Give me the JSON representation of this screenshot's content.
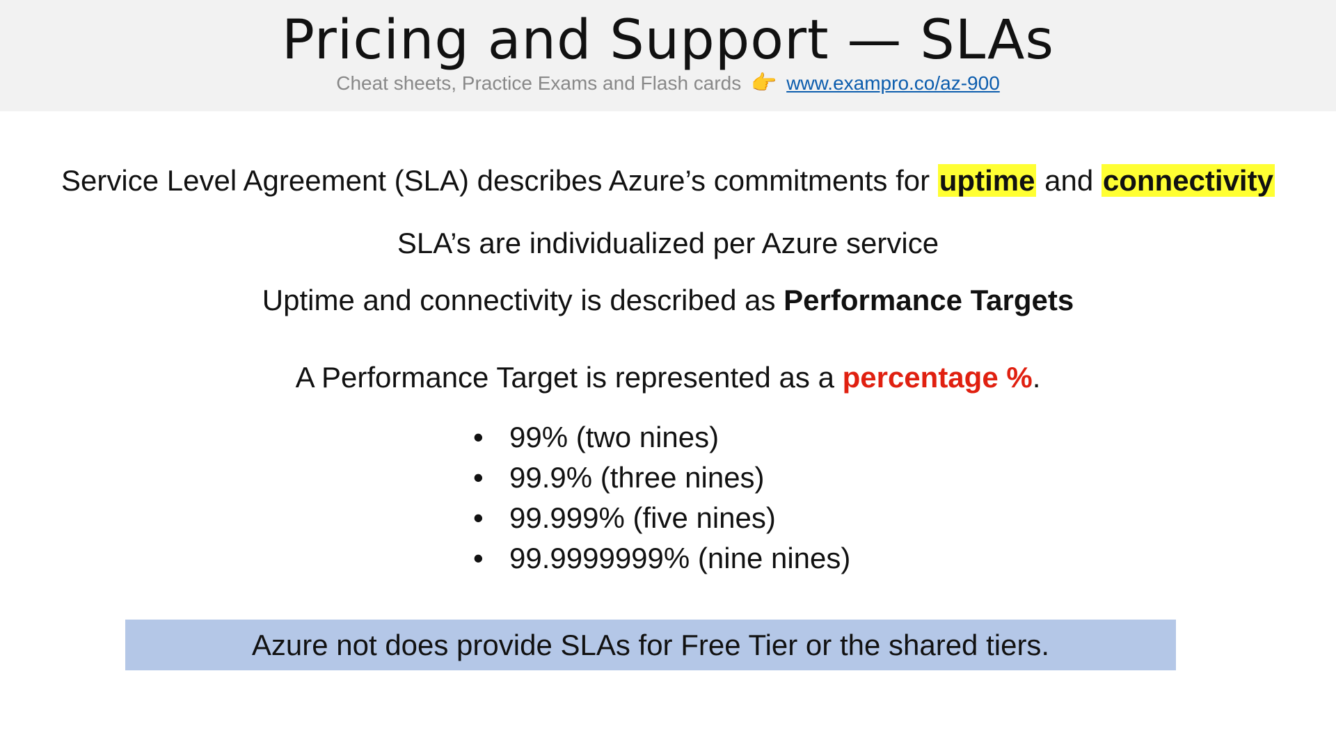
{
  "header": {
    "title": "Pricing and Support — SLAs",
    "subtitle_text": "Cheat sheets, Practice Exams and Flash cards",
    "subtitle_link": "www.exampro.co/az-900",
    "pointing_icon": "👉"
  },
  "body": {
    "line1": {
      "prefix": "Service Level Agreement (SLA) describes Azure’s commitments for ",
      "highlight1": "uptime",
      "middle": " and ",
      "highlight2": "connectivity"
    },
    "line2": "SLA’s are individualized per Azure service",
    "line3": {
      "prefix": "Uptime and connectivity is described as  ",
      "bold": "Performance Targets"
    },
    "line4": {
      "prefix": "A Performance Target is represented as a ",
      "emphasis": "percentage %",
      "suffix": "."
    },
    "bullet_glyph": "•",
    "bullets": [
      "99% (two nines)",
      "99.9% (three nines)",
      "99.999% (five nines)",
      "99.9999999% (nine nines)"
    ],
    "note": "Azure not does provide SLAs for Free Tier or the shared tiers."
  },
  "colors": {
    "highlight": "#ffff33",
    "emphasis_red": "#e02010",
    "note_background": "#b4c7e7",
    "link": "#0b5cad"
  }
}
